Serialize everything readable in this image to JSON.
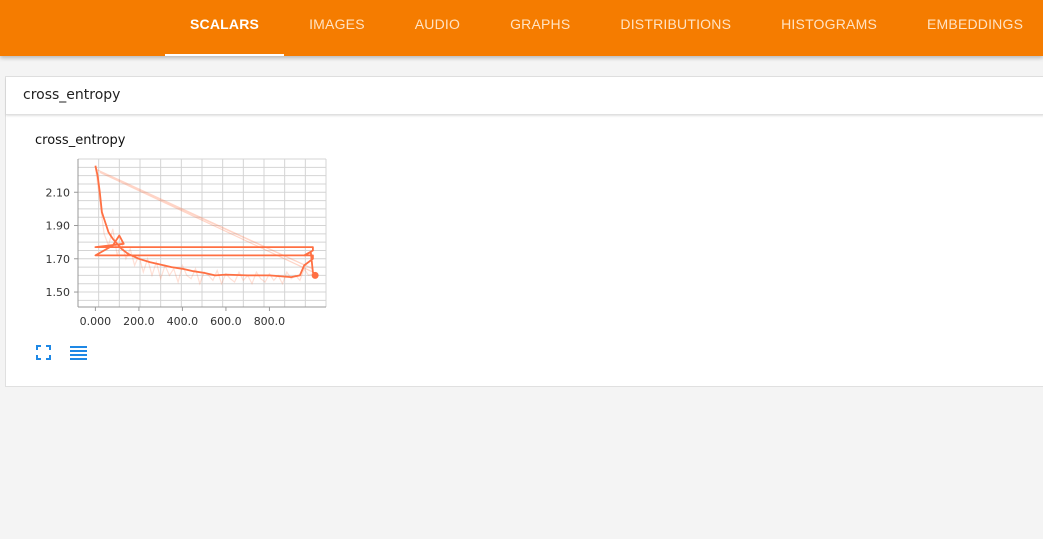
{
  "nav": {
    "tabs": [
      {
        "label": "SCALARS",
        "active": true
      },
      {
        "label": "IMAGES"
      },
      {
        "label": "AUDIO"
      },
      {
        "label": "GRAPHS"
      },
      {
        "label": "DISTRIBUTIONS"
      },
      {
        "label": "HISTOGRAMS"
      },
      {
        "label": "EMBEDDINGS"
      }
    ],
    "colors": {
      "bar": "#f57c00",
      "active_text": "#ffffff",
      "inactive_text": "#ffe3c4"
    }
  },
  "group": {
    "title": "cross_entropy",
    "card": {
      "title": "cross_entropy",
      "icons": [
        "fullscreen-icon",
        "log-scale-icon"
      ],
      "icon_color": "#1e88e5"
    }
  },
  "chart_data": {
    "type": "line",
    "title": "cross_entropy",
    "xlabel": "",
    "ylabel": "",
    "xlim": [
      -80,
      1060
    ],
    "ylim": [
      1.41,
      2.3
    ],
    "x_ticks": [
      0,
      200,
      400,
      600,
      800
    ],
    "x_tick_labels": [
      "0.000",
      "200.0",
      "400.0",
      "600.0",
      "800.0"
    ],
    "y_ticks": [
      1.5,
      1.7,
      1.9,
      2.1
    ],
    "y_tick_labels": [
      "1.50",
      "1.70",
      "1.90",
      "2.10"
    ],
    "grid": true,
    "series_color": "#ff7043",
    "series": [
      {
        "role": "smoothed",
        "x": [
          0,
          10,
          20,
          30,
          40,
          50,
          60,
          70,
          80,
          100,
          120,
          150,
          200,
          250,
          300,
          350,
          400,
          450,
          500,
          550,
          600,
          700,
          800,
          900,
          940,
          960,
          1000,
          1000,
          0,
          80,
          110,
          130,
          0,
          1000,
          1000,
          960,
          990,
          1000,
          1010
        ],
        "y": [
          2.26,
          2.2,
          2.1,
          1.98,
          1.94,
          1.9,
          1.86,
          1.84,
          1.82,
          1.79,
          1.76,
          1.73,
          1.7,
          1.68,
          1.665,
          1.65,
          1.64,
          1.625,
          1.615,
          1.6,
          1.605,
          1.6,
          1.6,
          1.59,
          1.6,
          1.66,
          1.7,
          1.72,
          1.72,
          1.78,
          1.84,
          1.79,
          1.77,
          1.77,
          1.75,
          1.72,
          1.74,
          1.62,
          1.6
        ]
      },
      {
        "role": "raw",
        "x": [
          0,
          20,
          40,
          60,
          80,
          100,
          120,
          140,
          160,
          180,
          200,
          220,
          240,
          260,
          280,
          300,
          320,
          340,
          360,
          380,
          400,
          420,
          440,
          460,
          480,
          500,
          520,
          540,
          560,
          580,
          600,
          620,
          640,
          660,
          680,
          700,
          720,
          740,
          760,
          780,
          800,
          820,
          840,
          860,
          880,
          900,
          920,
          940,
          960,
          980,
          1000
        ],
        "y": [
          2.25,
          2.05,
          1.85,
          1.78,
          1.88,
          1.72,
          1.8,
          1.7,
          1.76,
          1.66,
          1.72,
          1.62,
          1.7,
          1.6,
          1.68,
          1.58,
          1.66,
          1.6,
          1.64,
          1.56,
          1.66,
          1.6,
          1.58,
          1.64,
          1.55,
          1.62,
          1.6,
          1.57,
          1.63,
          1.55,
          1.61,
          1.58,
          1.56,
          1.62,
          1.57,
          1.6,
          1.55,
          1.62,
          1.58,
          1.56,
          1.61,
          1.57,
          1.6,
          1.55,
          1.62,
          1.58,
          1.6,
          1.57,
          1.64,
          1.6,
          1.61
        ]
      },
      {
        "role": "wraparound",
        "x": [
          0,
          1000,
          20,
          1000
        ],
        "y": [
          2.24,
          1.64,
          2.22,
          1.62
        ]
      }
    ]
  }
}
